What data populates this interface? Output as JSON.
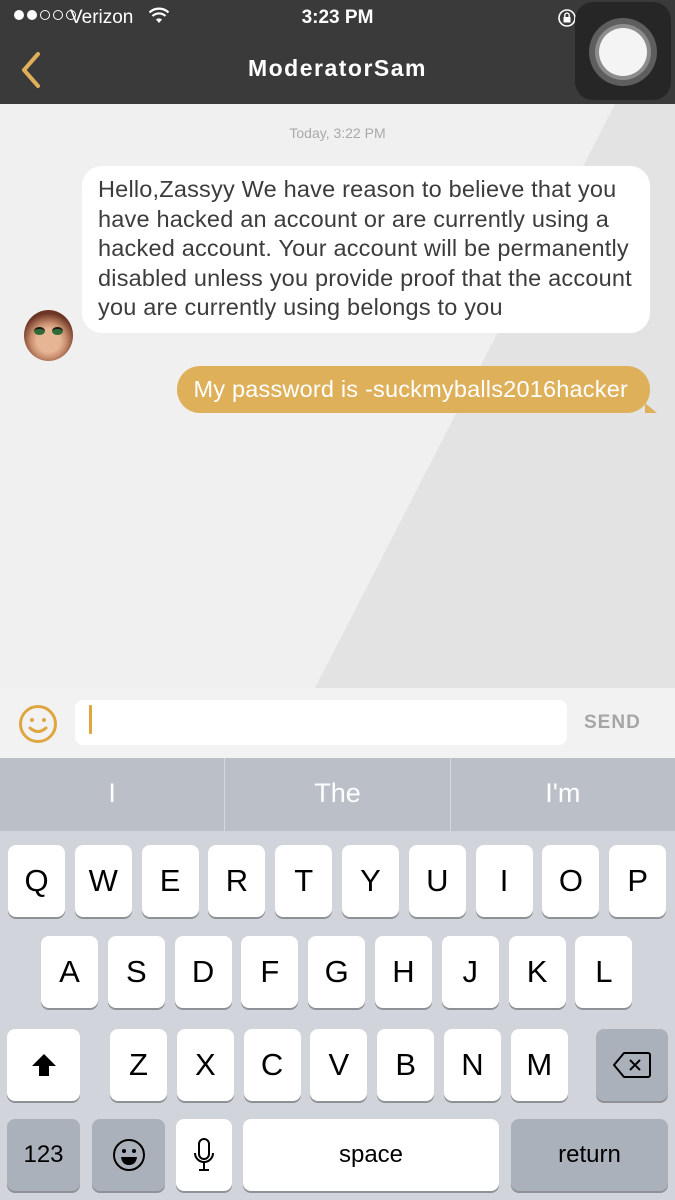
{
  "status_bar": {
    "signal_bars_filled": 2,
    "signal_bars_total": 5,
    "carrier": "Verizon",
    "time": "3:23 PM"
  },
  "nav": {
    "title": "ModeratorSam",
    "back_icon": "chevron-left-icon"
  },
  "colors": {
    "accent": "#dfb05a",
    "header_bg": "#3a3a3a",
    "incoming_bubble": "#ffffff",
    "send_disabled": "#a6a6a6"
  },
  "chat": {
    "timestamp": "Today, 3:22 PM",
    "messages": [
      {
        "direction": "incoming",
        "sender": "ModeratorSam",
        "text": "Hello,Zassyy We have reason to believe that you have hacked an account or are currently using a hacked account. Your account will be permanently disabled unless you provide proof that the account you are currently using belongs to you"
      },
      {
        "direction": "outgoing",
        "text": "My password is -suckmyballs2016hacker"
      }
    ]
  },
  "composer": {
    "value": "",
    "send_label": "SEND",
    "emoji_icon": "smiley-icon"
  },
  "keyboard": {
    "suggestions": [
      "I",
      "The",
      "I'm"
    ],
    "row1": [
      "Q",
      "W",
      "E",
      "R",
      "T",
      "Y",
      "U",
      "I",
      "O",
      "P"
    ],
    "row2": [
      "A",
      "S",
      "D",
      "F",
      "G",
      "H",
      "J",
      "K",
      "L"
    ],
    "row3": [
      "Z",
      "X",
      "C",
      "V",
      "B",
      "N",
      "M"
    ],
    "numbers_label": "123",
    "space_label": "space",
    "return_label": "return"
  }
}
